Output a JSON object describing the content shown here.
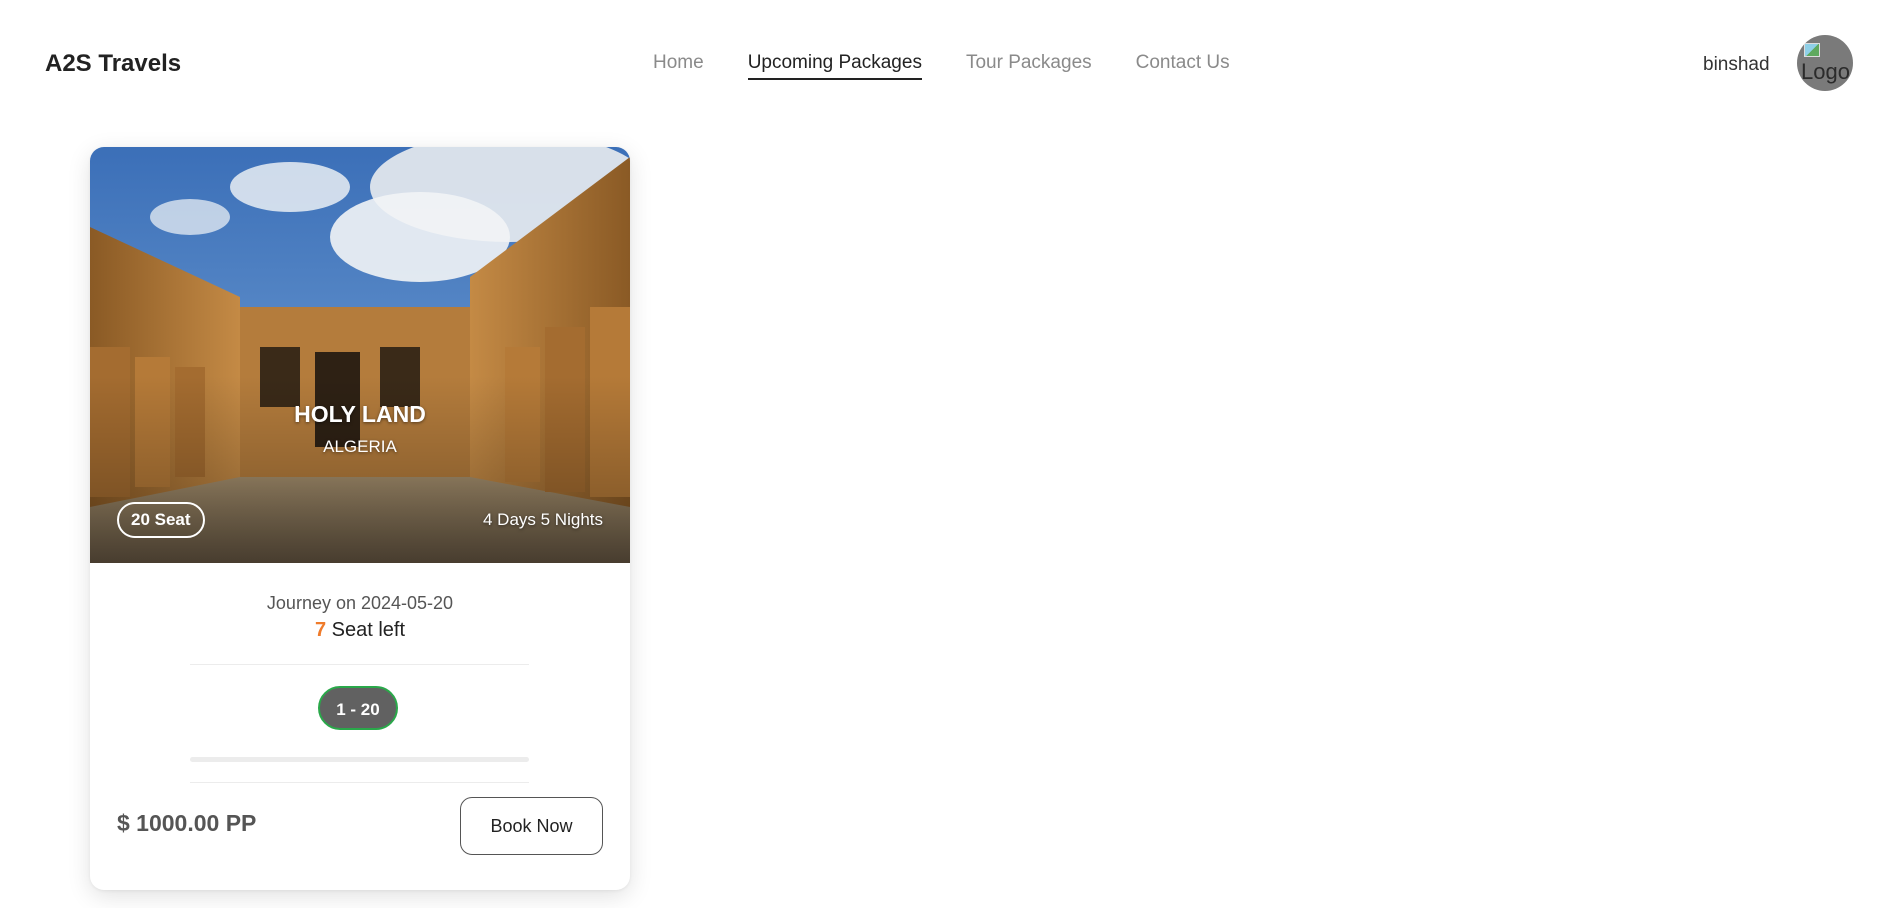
{
  "navbar": {
    "brand": "A2S Travels",
    "links": [
      {
        "label": "Home",
        "active": false
      },
      {
        "label": "Upcoming Packages",
        "active": true
      },
      {
        "label": "Tour Packages",
        "active": false
      },
      {
        "label": "Contact Us",
        "active": false
      }
    ],
    "username": "binshad",
    "avatar_alt": "Logo"
  },
  "package": {
    "title": "HOLY LAND",
    "country": "ALGERIA",
    "seat_badge": "20 Seat",
    "duration": "4 Days 5 Nights",
    "journey": "Journey on 2024-05-20",
    "seats_left_count": "7",
    "seats_left_label": " Seat left",
    "range": "1 - 20",
    "progress_fraction": 0,
    "price": "$ 1000.00 PP",
    "book_label": "Book Now"
  },
  "colors": {
    "accent_orange": "#ef7b2b",
    "accent_green": "#2aa84a",
    "pill_bg": "#616161"
  }
}
